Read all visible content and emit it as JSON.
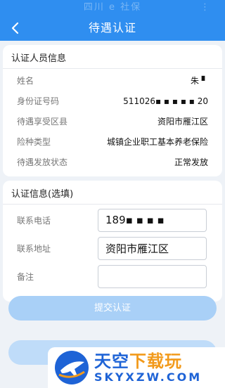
{
  "statusbar": {
    "faint_text": "四川 e 社保",
    "dot": "⋮"
  },
  "header": {
    "title": "待遇认证"
  },
  "person_section": {
    "title": "认证人员信息",
    "rows": [
      {
        "label": "姓名",
        "value": "朱 ▘"
      },
      {
        "label": "身份证号码",
        "value": "511026▪ ▪ ▪ ▪ ▪ 20"
      },
      {
        "label": "待遇享受区县",
        "value": "资阳市雁江区"
      },
      {
        "label": "险种类型",
        "value": "城镇企业职工基本养老保险"
      },
      {
        "label": "待遇发放状态",
        "value": "正常发放"
      }
    ]
  },
  "info_section": {
    "title": "认证信息(选填)",
    "phone": {
      "label": "联系电话",
      "value": "189▪ ▪ ▪ ▪"
    },
    "address": {
      "label": "联系地址",
      "value": "资阳市雁江区"
    },
    "remark": {
      "label": "备注",
      "value": ""
    }
  },
  "actions": {
    "submit": "提交认证"
  },
  "watermark": {
    "part1": "天空",
    "part2": "下载玩",
    "domain": "SKYXZW.COM"
  }
}
